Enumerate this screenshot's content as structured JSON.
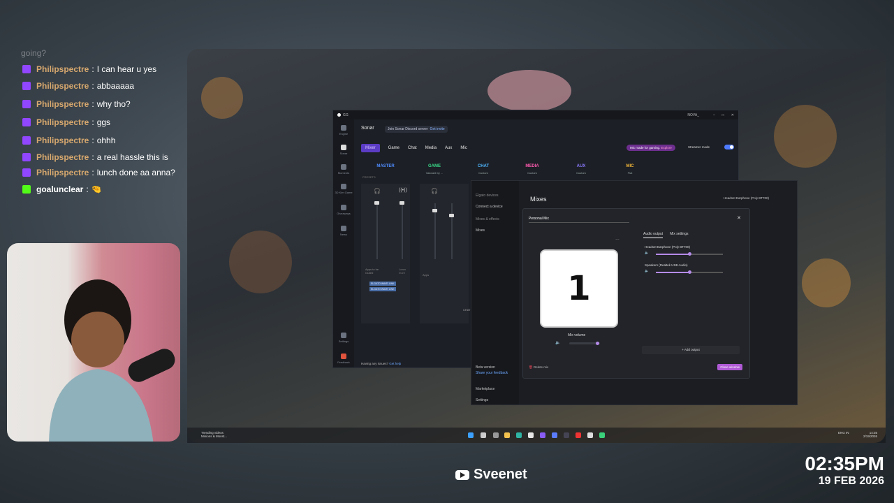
{
  "chat": {
    "faded_text": "going?",
    "messages": [
      {
        "user": "Philipspectre",
        "text": "I can hear u yes",
        "platform": "twitch"
      },
      {
        "user": "Philipspectre",
        "text": "abbaaaaa",
        "platform": "twitch"
      },
      {
        "user": "Philipspectre",
        "text": "why tho?",
        "platform": "twitch"
      },
      {
        "user": "Philipspectre",
        "text": "ggs",
        "platform": "twitch"
      },
      {
        "user": "Philipspectre",
        "text": "ohhh",
        "platform": "twitch"
      },
      {
        "user": "Philipspectre",
        "text": "a real hassle this is",
        "platform": "twitch"
      },
      {
        "user": "Philipspectre",
        "text": "lunch done aa anna?",
        "platform": "twitch"
      },
      {
        "user": "goalunclear",
        "text": "🤏",
        "platform": "kick"
      }
    ],
    "separator": ":"
  },
  "gg": {
    "title": "GG",
    "window_user": "NOVA_",
    "rail": [
      {
        "label": "Engine",
        "icon": "engine-icon"
      },
      {
        "label": "Sonar",
        "icon": "sonar-icon"
      },
      {
        "label": "Moments",
        "icon": "moments-icon"
      },
      {
        "label": "3D Kim Game",
        "icon": "3d-icon"
      },
      {
        "label": "Giveaways",
        "icon": "giveaways-icon"
      },
      {
        "label": "News",
        "icon": "news-icon"
      },
      {
        "label": "Settings",
        "icon": "gear-icon"
      },
      {
        "label": "Feedback",
        "icon": "feedback-icon"
      }
    ],
    "heading": "Sonar",
    "join_text": "Join Sonar Discord server",
    "join_link": "Get invite",
    "tabs": [
      "Mixer",
      "Game",
      "Chat",
      "Media",
      "Aux",
      "Mic"
    ],
    "promo_text": "Mic made for gaming.",
    "promo_link": "Explore",
    "streamer_mode": "Streamer mode",
    "presets_label": "PRESETS",
    "channels": [
      {
        "name": "MASTER",
        "sub": "",
        "color": "#4f8cff"
      },
      {
        "name": "GAME",
        "sub": "Valorant by ...",
        "color": "#39d98a"
      },
      {
        "name": "CHAT",
        "sub": "Custom",
        "color": "#4fb6ff"
      },
      {
        "name": "MEDIA",
        "sub": "Custom",
        "color": "#ff5ab0"
      },
      {
        "name": "AUX",
        "sub": "Custom",
        "color": "#8a7bff"
      },
      {
        "name": "MIC",
        "sub": "Flat",
        "color": "#f6b93b"
      }
    ],
    "apps_routed": "Apps to be routed",
    "learn_more": "Learn more",
    "apps_label": "Apps",
    "wave_tags": [
      "ELGATO WAVE LINK",
      "ELGATO WAVE LINK"
    ],
    "chat_label": "CHAT",
    "footer_q": "Having any issues?",
    "footer_link": "Get help"
  },
  "wave": {
    "title": "Wave Link",
    "side": {
      "elgato_devices": "Elgato devices",
      "connect": "Connect a device",
      "mixes_effects": "Mixes & effects",
      "mixes": "Mixes",
      "beta": "Beta version",
      "feedback": "Share your feedback",
      "marketplace": "Marketplace",
      "settings": "Settings"
    },
    "heading": "Mixes",
    "device": "Headset Earphone (Poly BT700)"
  },
  "modal": {
    "title": "Personal Mix",
    "card_number": "1",
    "mix_volume_label": "Mix volume",
    "mix_volume": 0.9,
    "tab_output": "Audio output",
    "tab_settings": "Mix settings",
    "outputs": [
      {
        "name": "Headset Earphone (Poly BT700)",
        "level": 0.5
      },
      {
        "name": "Speakers (Realtek USB Audio)",
        "level": 0.5
      }
    ],
    "add_output": "Add output",
    "delete_mix": "Delete mix",
    "close_window": "Close window"
  },
  "taskbar": {
    "news_title": "Trending videos",
    "news_sub": "Minions & Monst...",
    "lang": "ENG IN",
    "time": "14:35",
    "date": "2/19/2026"
  },
  "overlay": {
    "channel_name": "Sveenet",
    "time": "02:35PM",
    "date": "19 FEB 2026"
  }
}
